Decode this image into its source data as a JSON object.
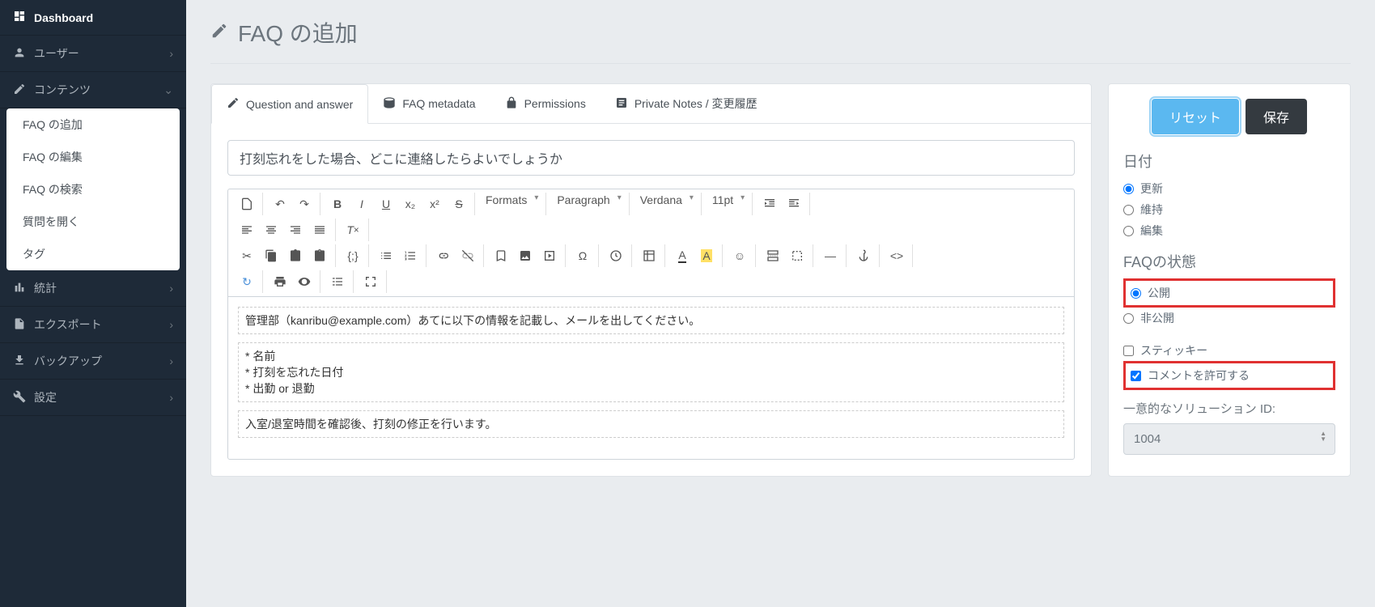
{
  "sidebar": {
    "dashboard": "Dashboard",
    "users": "ユーザー",
    "contents": "コンテンツ",
    "submenu": {
      "add_faq": "FAQ の追加",
      "edit_faq": "FAQ の編集",
      "search_faq": "FAQ の検索",
      "open_question": "質問を開く",
      "tag": "タグ"
    },
    "stats": "統計",
    "export": "エクスポート",
    "backup": "バックアップ",
    "settings": "設定"
  },
  "page": {
    "title": "FAQ の追加"
  },
  "tabs": {
    "qa": "Question and answer",
    "metadata": "FAQ metadata",
    "permissions": "Permissions",
    "notes": "Private Notes / 変更履歴"
  },
  "question": "打刻忘れをした場合、どこに連絡したらよいでしょうか",
  "editor_toolbar": {
    "formats": "Formats",
    "paragraph": "Paragraph",
    "font": "Verdana",
    "size": "11pt"
  },
  "editor_content": {
    "p1": "管理部（kanribu@example.com）あてに以下の情報を記載し、メールを出してください。",
    "l1": "* 名前",
    "l2": "* 打刻を忘れた日付",
    "l3": "* 出勤 or 退勤",
    "p2": "入室/退室時間を確認後、打刻の修正を行います。"
  },
  "right": {
    "reset": "リセット",
    "save": "保存",
    "date_title": "日付",
    "date_update": "更新",
    "date_keep": "維持",
    "date_edit": "編集",
    "state_title": "FAQの状態",
    "state_public": "公開",
    "state_private": "非公開",
    "sticky": "スティッキー",
    "allow_comments": "コメントを許可する",
    "solution_id_label": "一意的なソリューション ID:",
    "solution_id": "1004"
  }
}
